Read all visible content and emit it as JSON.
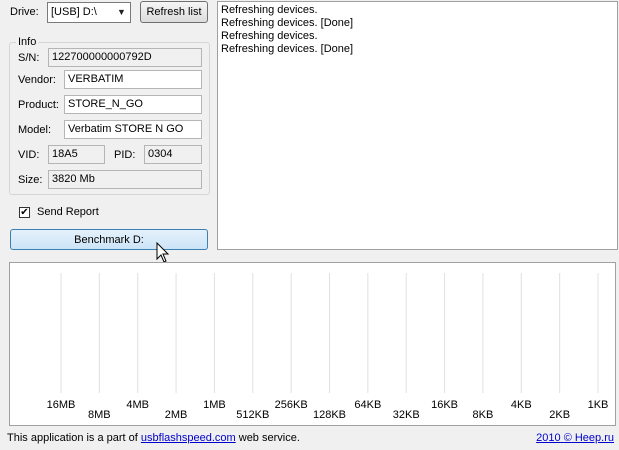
{
  "drive": {
    "label": "Drive:",
    "selected": "[USB] D:\\",
    "refresh_label": "Refresh list"
  },
  "info": {
    "title": "Info",
    "sn": {
      "label": "S/N:",
      "value": "122700000000792D"
    },
    "vendor": {
      "label": "Vendor:",
      "value": "VERBATIM"
    },
    "product": {
      "label": "Product:",
      "value": "STORE_N_GO"
    },
    "model": {
      "label": "Model:",
      "value": "Verbatim STORE N GO"
    },
    "vid": {
      "label": "VID:",
      "value": "18A5"
    },
    "pid": {
      "label": "PID:",
      "value": "0304"
    },
    "size": {
      "label": "Size:",
      "value": "3820 Mb"
    }
  },
  "send_report": {
    "label": "Send Report",
    "checked": true
  },
  "benchmark_label": "Benchmark D:",
  "log": [
    "Refreshing devices.",
    "Refreshing devices. [Done]",
    "Refreshing devices.",
    "Refreshing devices. [Done]"
  ],
  "chart_data": {
    "type": "bar",
    "categories": [
      "16MB",
      "8MB",
      "4MB",
      "2MB",
      "1MB",
      "512KB",
      "256KB",
      "128KB",
      "64KB",
      "32KB",
      "16KB",
      "8KB",
      "4KB",
      "2KB",
      "1KB"
    ],
    "series": []
  },
  "footer": {
    "prefix": "This application is a part of ",
    "link": "usbflashspeed.com",
    "suffix": " web service.",
    "year": "2010",
    "copyright": "©",
    "brand": "Heep.ru"
  },
  "colors": {
    "accent": "#cce4f7",
    "link": "#0000cc",
    "gridline": "#e0e0e0"
  }
}
